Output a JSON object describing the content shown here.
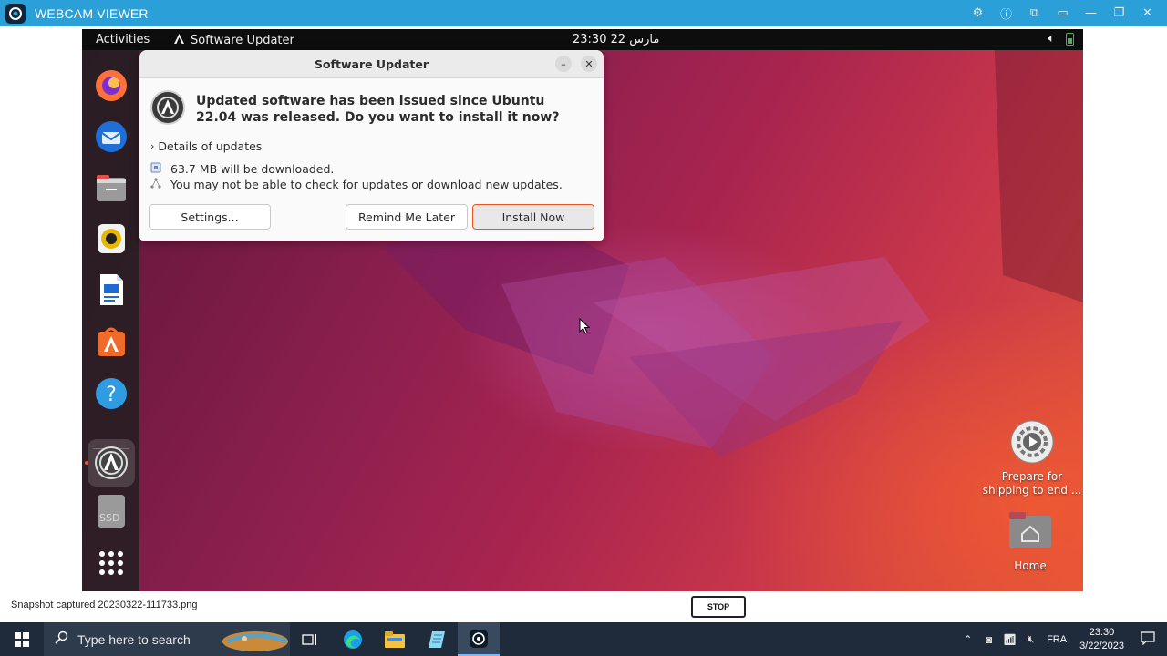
{
  "viewer": {
    "title": "WEBCAM VIEWER",
    "status_text": "Snapshot captured 20230322-111733.png",
    "stop_label": "STOP",
    "controls": [
      "gear-icon",
      "info-icon",
      "popout-icon",
      "window-icon",
      "minimize-icon",
      "restore-icon",
      "close-icon"
    ]
  },
  "ubuntu": {
    "topbar": {
      "activities": "Activities",
      "app_name": "Software Updater",
      "clock": "23:30  مارس 22"
    },
    "dock": [
      "firefox-icon",
      "thunderbird-icon",
      "files-icon",
      "rhythmbox-icon",
      "writer-icon",
      "app-center-icon",
      "help-icon",
      "software-updater-icon",
      "ssd-drive-icon",
      "show-apps-icon"
    ],
    "ssd_label": "SSD",
    "dialog": {
      "title": "Software Updater",
      "headline": "Updated software has been issued since Ubuntu 22.04 was released. Do you want to install it now?",
      "details_label": "Details of updates",
      "download_size": "63.7 MB will be downloaded.",
      "warning": "You may not be able to check for updates or download new updates.",
      "settings_label": "Settings...",
      "remind_label": "Remind Me Later",
      "install_label": "Install Now"
    },
    "desktop_icons": {
      "prepare_label": "Prepare for shipping to end ...",
      "home_label": "Home"
    }
  },
  "taskbar": {
    "search_placeholder": "Type here to search",
    "language": "FRA",
    "time": "23:30",
    "date": "3/22/2023"
  },
  "colors": {
    "viewer_title_bg": "#2a9fd8",
    "ubuntu_orange": "#e95420",
    "taskbar_bg": "#1f2b3a"
  }
}
